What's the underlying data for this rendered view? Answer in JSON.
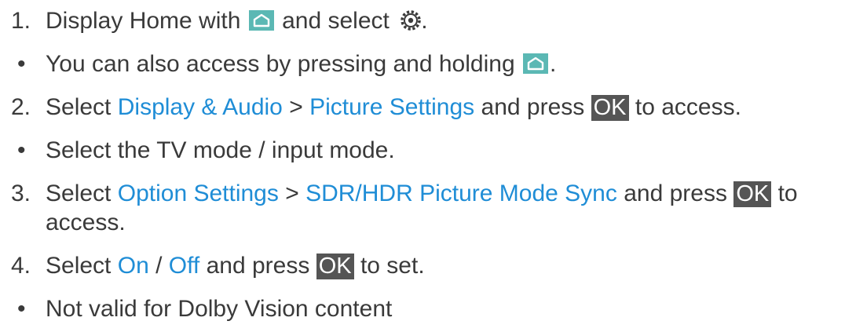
{
  "steps": [
    {
      "num": "1.",
      "pre": "Display Home with",
      "mid": "and select",
      "post": "."
    },
    {
      "bullet": "•",
      "pre": "You can also access by pressing and holding",
      "post": "."
    },
    {
      "num": "2.",
      "pre": "Select",
      "link1": "Display & Audio",
      "sep": ">",
      "link2": "Picture Settings",
      "mid": "and press",
      "ok": "OK",
      "post": "to access."
    },
    {
      "bullet": "•",
      "text": "Select the TV mode / input mode."
    },
    {
      "num": "3.",
      "pre": "Select",
      "link1": "Option Settings",
      "sep": ">",
      "link2": "SDR/HDR Picture Mode Sync",
      "mid": "and press",
      "ok": "OK",
      "post": "to",
      "cont": "access."
    },
    {
      "num": "4.",
      "pre": "Select",
      "link1": "On",
      "sep": "/",
      "link2": "Off",
      "mid": "and press",
      "ok": "OK",
      "post": "to set."
    },
    {
      "bullet": "•",
      "text": "Not valid for Dolby Vision content"
    }
  ],
  "icons": {
    "home": "home-icon",
    "gear": "gear-icon"
  },
  "colors": {
    "text": "#3a3a3a",
    "link": "#1f8dd6",
    "ok_bg": "#555555",
    "ok_fg": "#ffffff",
    "icon_bg": "#5bb8b4"
  }
}
